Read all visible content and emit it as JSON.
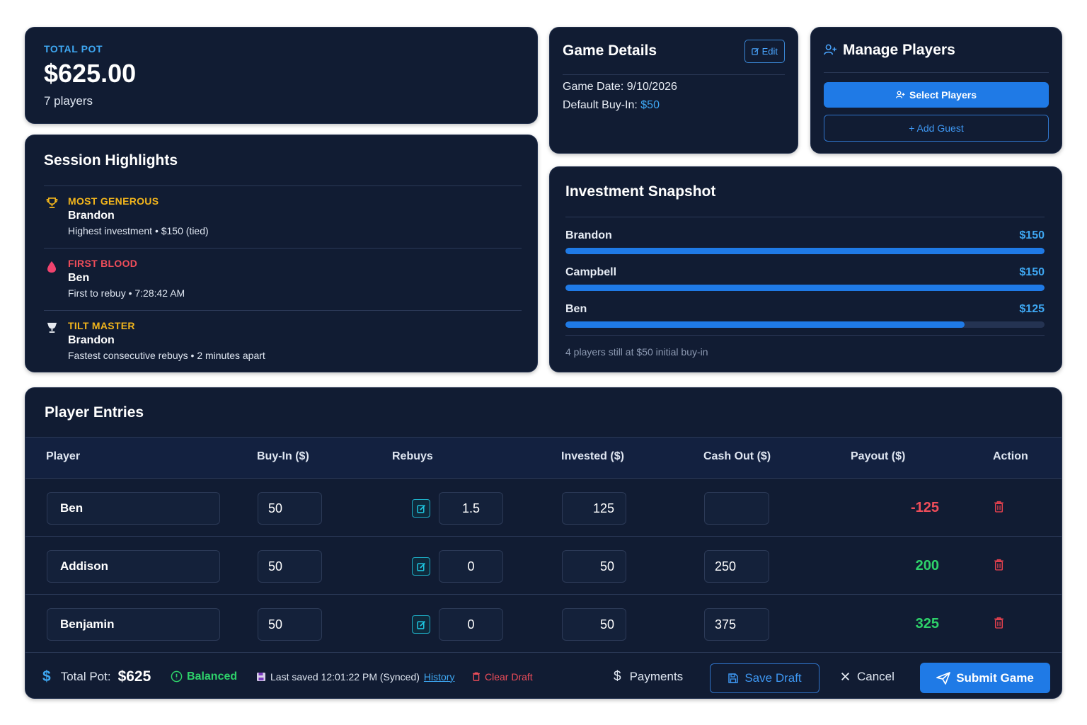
{
  "pot": {
    "label": "TOTAL POT",
    "amount": "$625.00",
    "players": "7 players"
  },
  "details": {
    "title": "Game Details",
    "edit_label": "Edit",
    "date_label": "Game Date:",
    "date_value": "9/10/2026",
    "buyin_label": "Default Buy-In:",
    "buyin_value": "$50"
  },
  "manage": {
    "title": "Manage Players",
    "select_label": "Select Players",
    "add_guest_label": "+ Add Guest"
  },
  "highlights": {
    "title": "Session Highlights",
    "items": [
      {
        "title": "MOST GENEROUS",
        "name": "Brandon",
        "desc": "Highest investment • $150 (tied)",
        "icon": "trophy-icon"
      },
      {
        "title": "FIRST BLOOD",
        "name": "Ben",
        "desc": "First to rebuy • 7:28:42 AM",
        "icon": "blood-drop-icon"
      },
      {
        "title": "TILT MASTER",
        "name": "Brandon",
        "desc": "Fastest consecutive rebuys • 2 minutes apart",
        "icon": "tilt-cup-icon"
      }
    ]
  },
  "snapshot": {
    "title": "Investment Snapshot",
    "rows": [
      {
        "name": "Brandon",
        "amount": "$150",
        "fraction": 1.0
      },
      {
        "name": "Campbell",
        "amount": "$150",
        "fraction": 1.0
      },
      {
        "name": "Ben",
        "amount": "$125",
        "fraction": 0.833
      }
    ],
    "note": "4 players still at $50 initial buy-in"
  },
  "entries": {
    "title": "Player Entries",
    "columns": [
      "Player",
      "Buy-In ($)",
      "Rebuys",
      "Invested ($)",
      "Cash Out ($)",
      "Payout ($)",
      "Action"
    ],
    "rows": [
      {
        "player": "Ben",
        "buyin": "50",
        "rebuys": "1.5",
        "invested": "125",
        "cashout": "",
        "payout": "-125",
        "sign": "neg"
      },
      {
        "player": "Addison",
        "buyin": "50",
        "rebuys": "0",
        "invested": "50",
        "cashout": "250",
        "payout": "200",
        "sign": "pos"
      },
      {
        "player": "Benjamin",
        "buyin": "50",
        "rebuys": "0",
        "invested": "50",
        "cashout": "375",
        "payout": "325",
        "sign": "pos"
      }
    ]
  },
  "footer": {
    "total_label": "Total Pot:",
    "total_value": "$625",
    "balanced": "Balanced",
    "saved_text": "Last saved 12:01:22 PM (Synced)",
    "history": "History",
    "clear_draft": "Clear Draft",
    "payments": "Payments",
    "save_draft": "Save Draft",
    "cancel": "Cancel",
    "submit": "Submit Game"
  },
  "colors": {
    "card": "#111c33",
    "accent": "#1f7ae6",
    "gold": "#f2b51c",
    "red": "#ef4d5a",
    "green": "#2ed16a"
  }
}
